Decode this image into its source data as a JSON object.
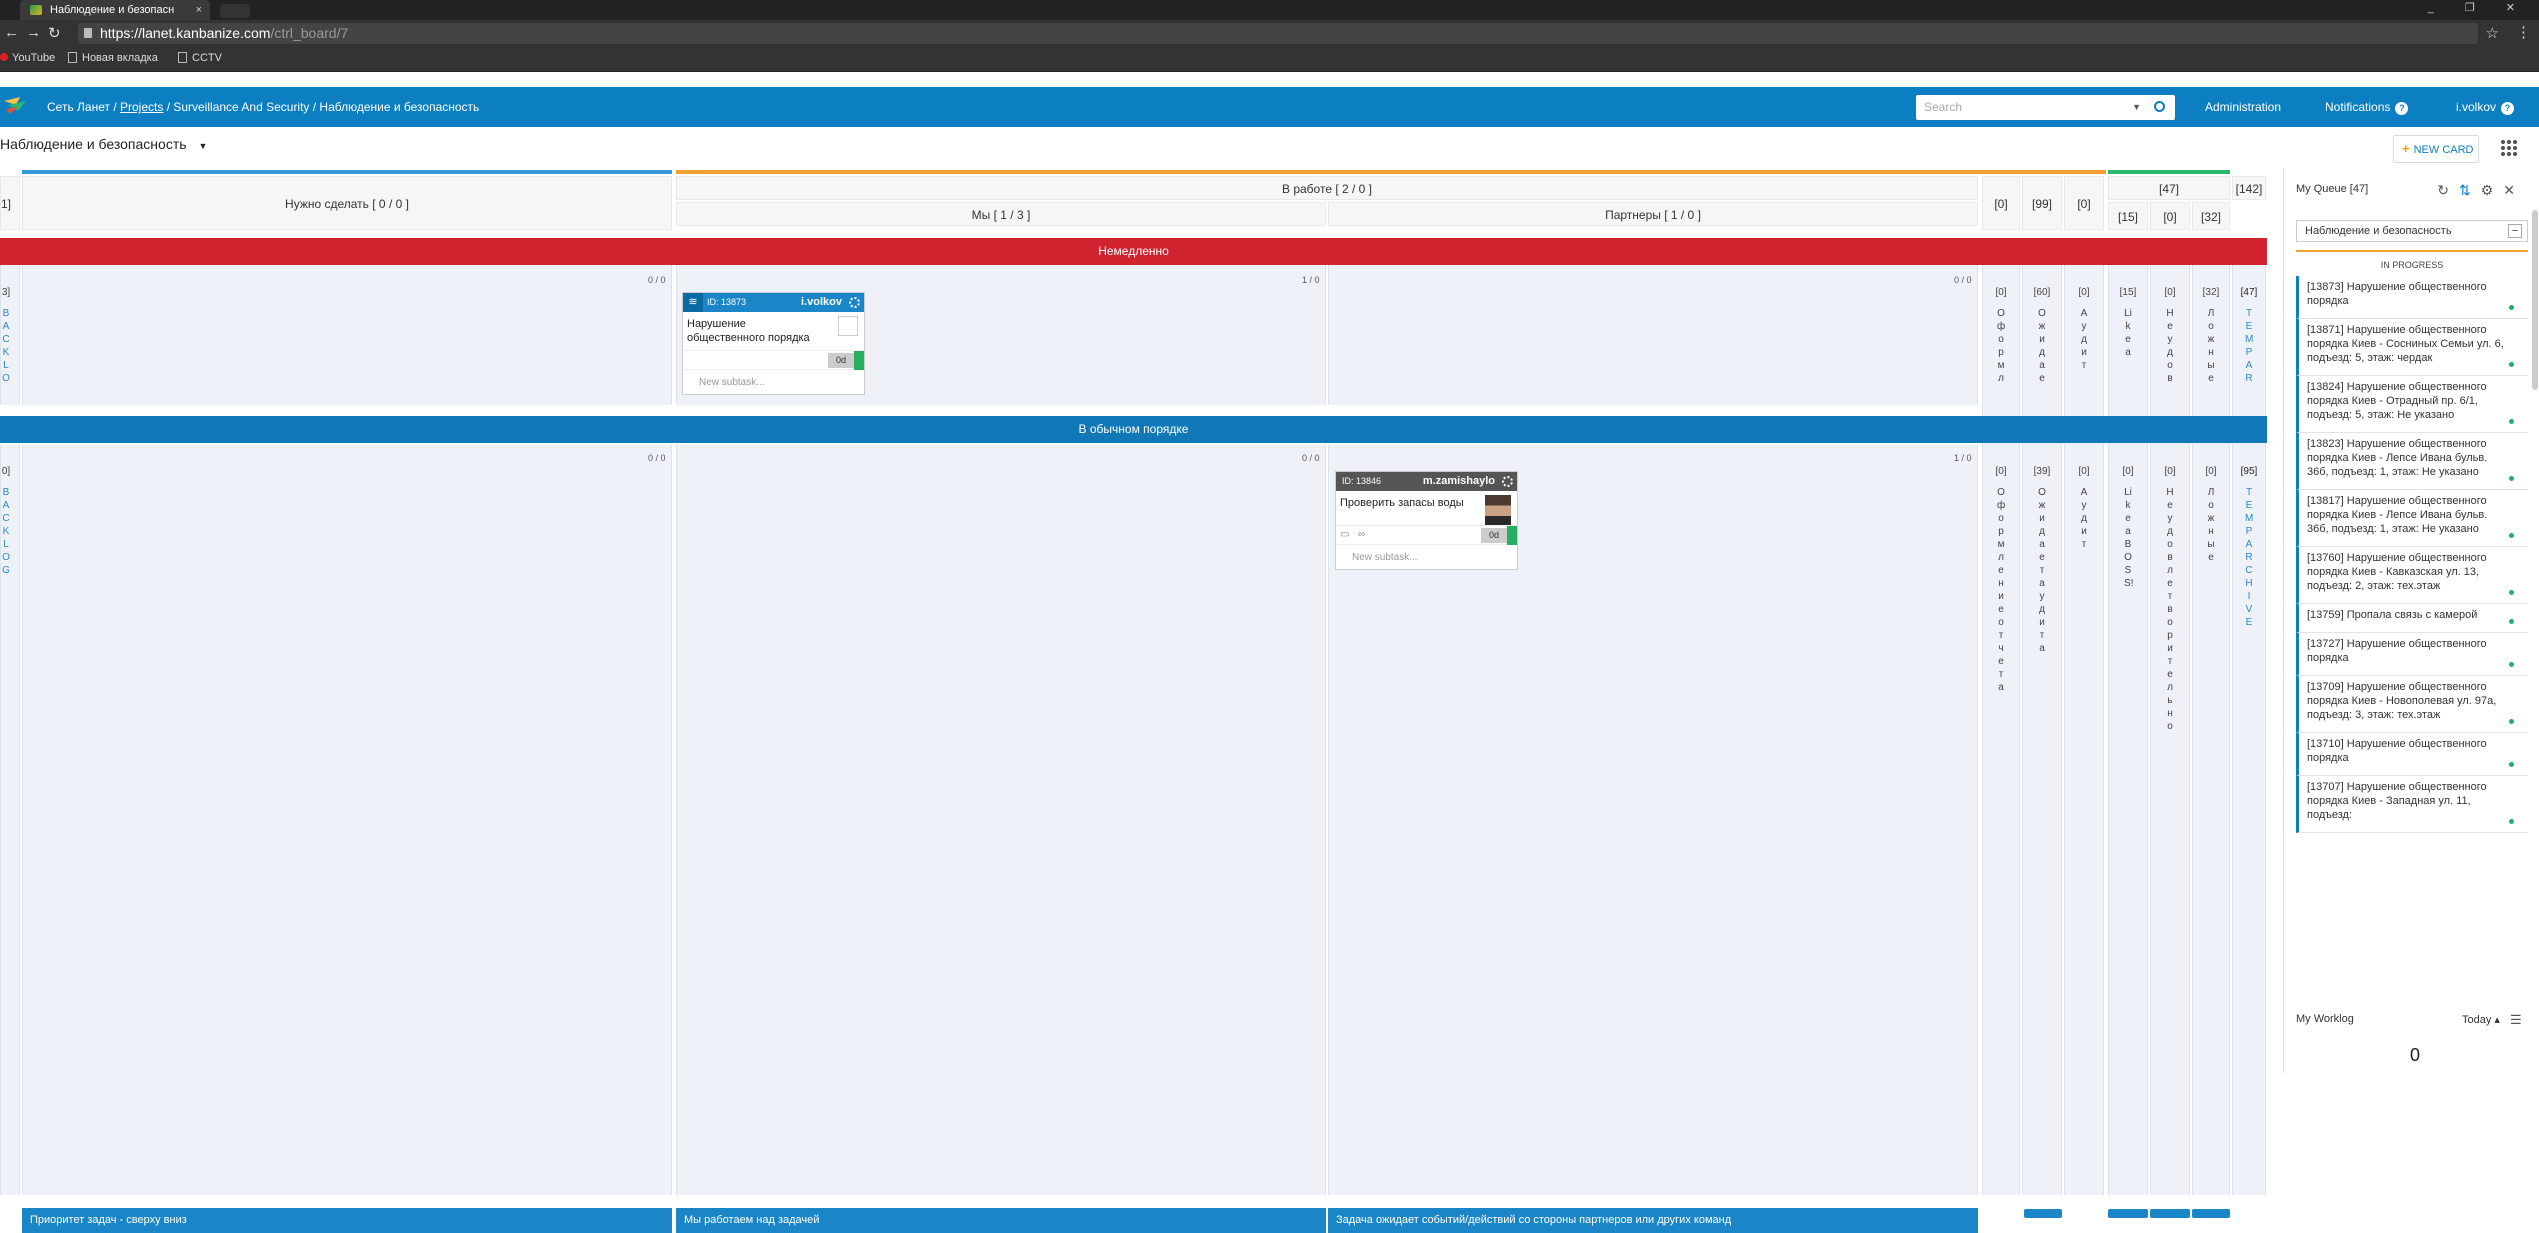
{
  "browser": {
    "tab_title": "Наблюдение и безопасн",
    "tab_close": "×",
    "window_controls": "_ ❐ ✕",
    "url_host": "https://lanet.kanbanize.com",
    "url_path": "/ctrl_board/7",
    "bookmarks": [
      {
        "label": "YouTube"
      },
      {
        "label": "Новая вкладка"
      },
      {
        "label": "CCTV"
      }
    ]
  },
  "header": {
    "crumb_root": "Сеть Ланет",
    "crumb_sep1": " / ",
    "crumb_projects": "Projects",
    "crumb_rest": " / Surveillance And Security / Наблюдение и безопасность",
    "search_placeholder": "Search",
    "administration": "Administration",
    "notifications": "Notifications",
    "user": "i.volkov"
  },
  "board": {
    "title": "Наблюдение и безопасность",
    "new_card": "NEW CARD",
    "columns": {
      "left_edge": "1]",
      "todo": "Нужно сделать  [ 0 / 0 ]",
      "in_progress": "В работе  [ 2 / 0 ]",
      "we": "Мы  [ 1 / 3 ]",
      "partners": "Партнеры  [ 1 / 0 ]",
      "c0a": "[0]",
      "c99": "[99]",
      "c0b": "[0]",
      "c47": "[47]",
      "c15": "[15]",
      "c0c": "[0]",
      "c32": "[32]",
      "c142": "[142]"
    },
    "swimlanes": {
      "urgent": "Немедленно",
      "normal": "В обычном порядке"
    },
    "counts": {
      "u_todo": "0 / 0",
      "u_we": "1 / 0",
      "u_partners": "0 / 0",
      "n_todo": "0 / 0",
      "n_we": "0 / 0",
      "n_partners": "1 / 0"
    },
    "urgent_vert": [
      {
        "h": "[0]",
        "t": "Оформл"
      },
      {
        "h": "[60]",
        "t": "Ожидае"
      },
      {
        "h": "[0]",
        "t": "Аудит"
      },
      {
        "h": "[15]",
        "t": "Like a"
      },
      {
        "h": "[0]",
        "t": "Неудов"
      },
      {
        "h": "[32]",
        "t": "Ложные"
      },
      {
        "h": "[47]",
        "t": "TEMP AR"
      }
    ],
    "normal_vert": [
      {
        "h": "[0]",
        "t": "Оформление отчета"
      },
      {
        "h": "[39]",
        "t": "Ожидает аудита"
      },
      {
        "h": "[0]",
        "t": "Аудит"
      },
      {
        "h": "[0]",
        "t": "Like a BOSS!"
      },
      {
        "h": "[0]",
        "t": "Неудовлетворительно"
      },
      {
        "h": "[0]",
        "t": "Ложные"
      },
      {
        "h": "[95]",
        "t": "TEMP ARCHIVE"
      }
    ],
    "left_vert_urgent": {
      "h": "3]",
      "t": "BACKLO"
    },
    "left_vert_normal": {
      "h": "0]",
      "t": "BACKLOG"
    },
    "cards": [
      {
        "id": "ID: 13873",
        "owner": "i.volkov",
        "title": "Нарушение общественного порядка",
        "age": "0d",
        "subtask": "New subtask..."
      },
      {
        "id": "ID: 13846",
        "owner": "m.zamishaylo",
        "title": "Проверить запасы воды",
        "age": "0d",
        "subtask": "New subtask..."
      }
    ],
    "footer": {
      "todo": "Приоритет задач - сверху вниз",
      "we": "Мы работаем над задачей",
      "partners": "Задача ожидает событий/действий со стороны партнеров или других команд"
    }
  },
  "panel": {
    "title": "My Queue [47]",
    "selector": "Наблюдение и безопасность",
    "minus": "−",
    "section": "IN PROGRESS",
    "items": [
      "[13873] Нарушение общественного порядка",
      "[13871] Нарушение общественного порядка Киев - Сосниных Семьи ул. 6, подъезд: 5, этаж: чердак",
      "[13824] Нарушение общественного порядка Киев - Отрадный пр. 6/1, подъезд: 5, этаж: Не указано",
      "[13823] Нарушение общественного порядка Киев - Лепсе Ивана бульв. 36б, подъезд: 1, этаж: Не указано",
      "[13817] Нарушение общественного порядка Киев - Лепсе Ивана бульв. 36б, подъезд: 1, этаж: Не указано",
      "[13760] Нарушение общественного порядка Киев - Кавказская ул. 13, подъезд: 2, этаж: тех.этаж",
      "[13759] Пропала связь с камерой",
      "[13727] Нарушение общественного порядка",
      "[13709] Нарушение общественного порядка Киев - Новополевая ул. 97а, подъезд: 3, этаж: тех.этаж",
      "[13710] Нарушение общественного порядка",
      "[13707] Нарушение общественного порядка Киев - Западная ул. 11, подъезд:"
    ],
    "worklog": "My Worklog",
    "today": "Today ▴",
    "worklog_count": "0"
  }
}
